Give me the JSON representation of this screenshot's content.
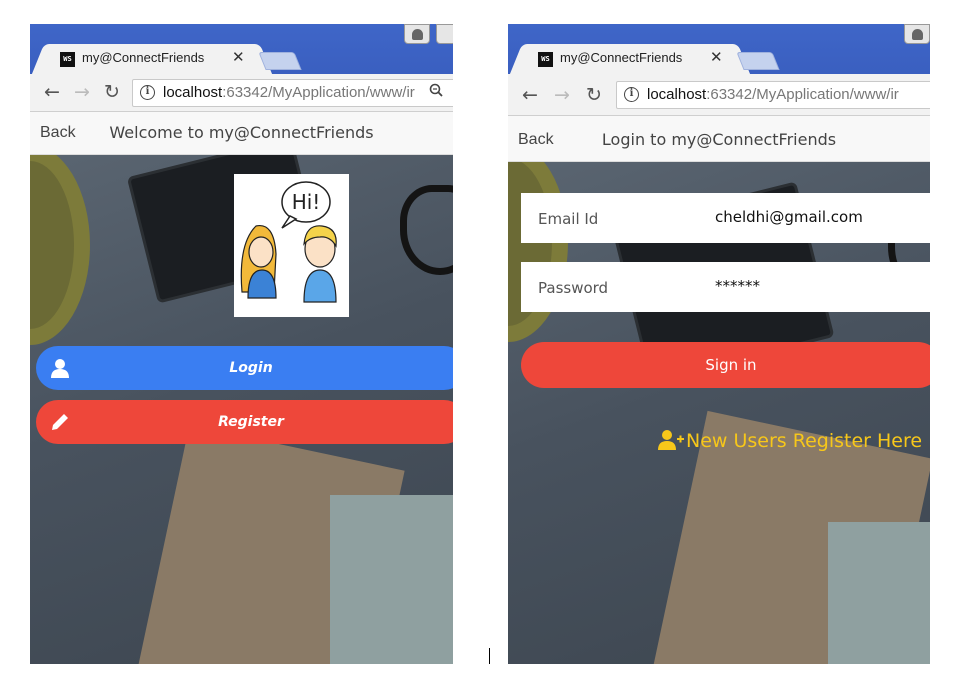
{
  "left": {
    "tab_title": "my@ConnectFriends",
    "favicon_text": "WS",
    "url_host": "localhost",
    "url_path": ":63342/MyApplication/www/ir",
    "back_label": "Back",
    "app_title": "Welcome to my@ConnectFriends",
    "hi_text": "Hi!",
    "login_label": "Login",
    "register_label": "Register",
    "icons": [
      "back-arrow-icon",
      "forward-arrow-icon",
      "reload-icon",
      "info-icon",
      "zoom-icon",
      "user-icon",
      "pencil-icon"
    ]
  },
  "right": {
    "tab_title": "my@ConnectFriends",
    "favicon_text": "WS",
    "url_host": "localhost",
    "url_path": ":63342/MyApplication/www/ir",
    "back_label": "Back",
    "app_title": "Login to my@ConnectFriends",
    "email_label": "Email Id",
    "email_value": "cheldhi@gmail.com",
    "password_label": "Password",
    "password_value": "******",
    "signin_label": "Sign in",
    "register_link_label": "New Users Register Here",
    "icons": [
      "add-user-icon"
    ]
  },
  "colors": {
    "login_blue": "#3a7ef2",
    "register_red": "#ee473a",
    "link_yellow": "#f7c71a",
    "chrome_blue": "#3f66c8"
  }
}
